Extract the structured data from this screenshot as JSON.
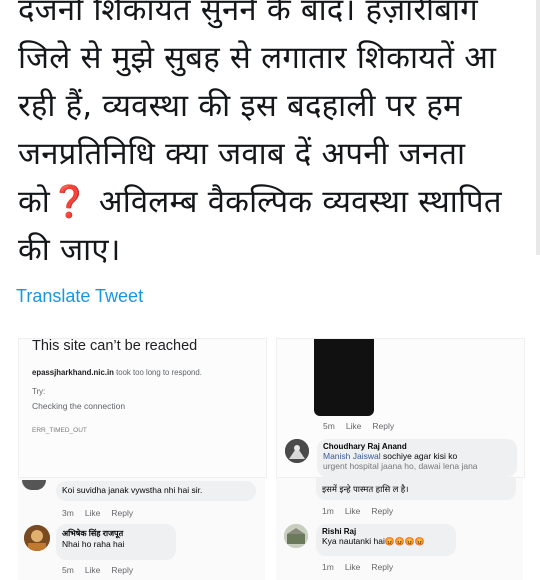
{
  "tweet": {
    "text_before": "दजनो शिकायत सुनने के बाद। हज़ारीबाग\nजिले से मुझे सुबह से लगातार शिकायतें आ\nरही हैं, व्यवस्था की इस बदहाली पर हम\nजनप्रतिनिधि क्या जवाब दें अपनी जनता\nको",
    "emoji": "❓",
    "text_after": " अविलम्ब वैकल्पिक व्यवस्था स्थापित\nकी जाए।",
    "translate_label": "Translate Tweet"
  },
  "screenshot_error": {
    "title": "This site can’t be reached",
    "domain": "epassjharkhand.nic.in",
    "message": " took too long to respond.",
    "try_label": "Try:",
    "suggestion": "Checking the connection",
    "error_code": "ERR_TIMED_OUT"
  },
  "screenshot_comments_right": {
    "meta_1": {
      "time": "5m",
      "like": "Like",
      "reply": "Reply"
    },
    "comment_1": {
      "name": "Choudhary Raj Anand",
      "tag": "Manish Jaiswal",
      "text": " sochiye agar kisi ko",
      "text_cut": "urgent hospital jaana ho, dawai lena jana"
    },
    "comment_1b": {
      "text": "इसमें इन्हे पास्मत हासि ल है।"
    },
    "meta_2": {
      "time": "1m",
      "like": "Like",
      "reply": "Reply"
    },
    "comment_2": {
      "name": "Rishi Raj",
      "text": "Kya nautanki hai",
      "emoji": "😡😡😡😡"
    },
    "meta_3": {
      "time": "1m",
      "like": "Like",
      "reply": "Reply"
    }
  },
  "screenshot_comments_left": {
    "comment_1": {
      "text": "Koi suvidha janak vywstha nhi hai sir."
    },
    "meta_1": {
      "time": "3m",
      "like": "Like",
      "reply": "Reply"
    },
    "comment_2": {
      "name": "अभिषेक सिंह राजपूत",
      "text": "Nhai ho raha hai"
    },
    "meta_2": {
      "time": "5m",
      "like": "Like",
      "reply": "Reply"
    }
  }
}
